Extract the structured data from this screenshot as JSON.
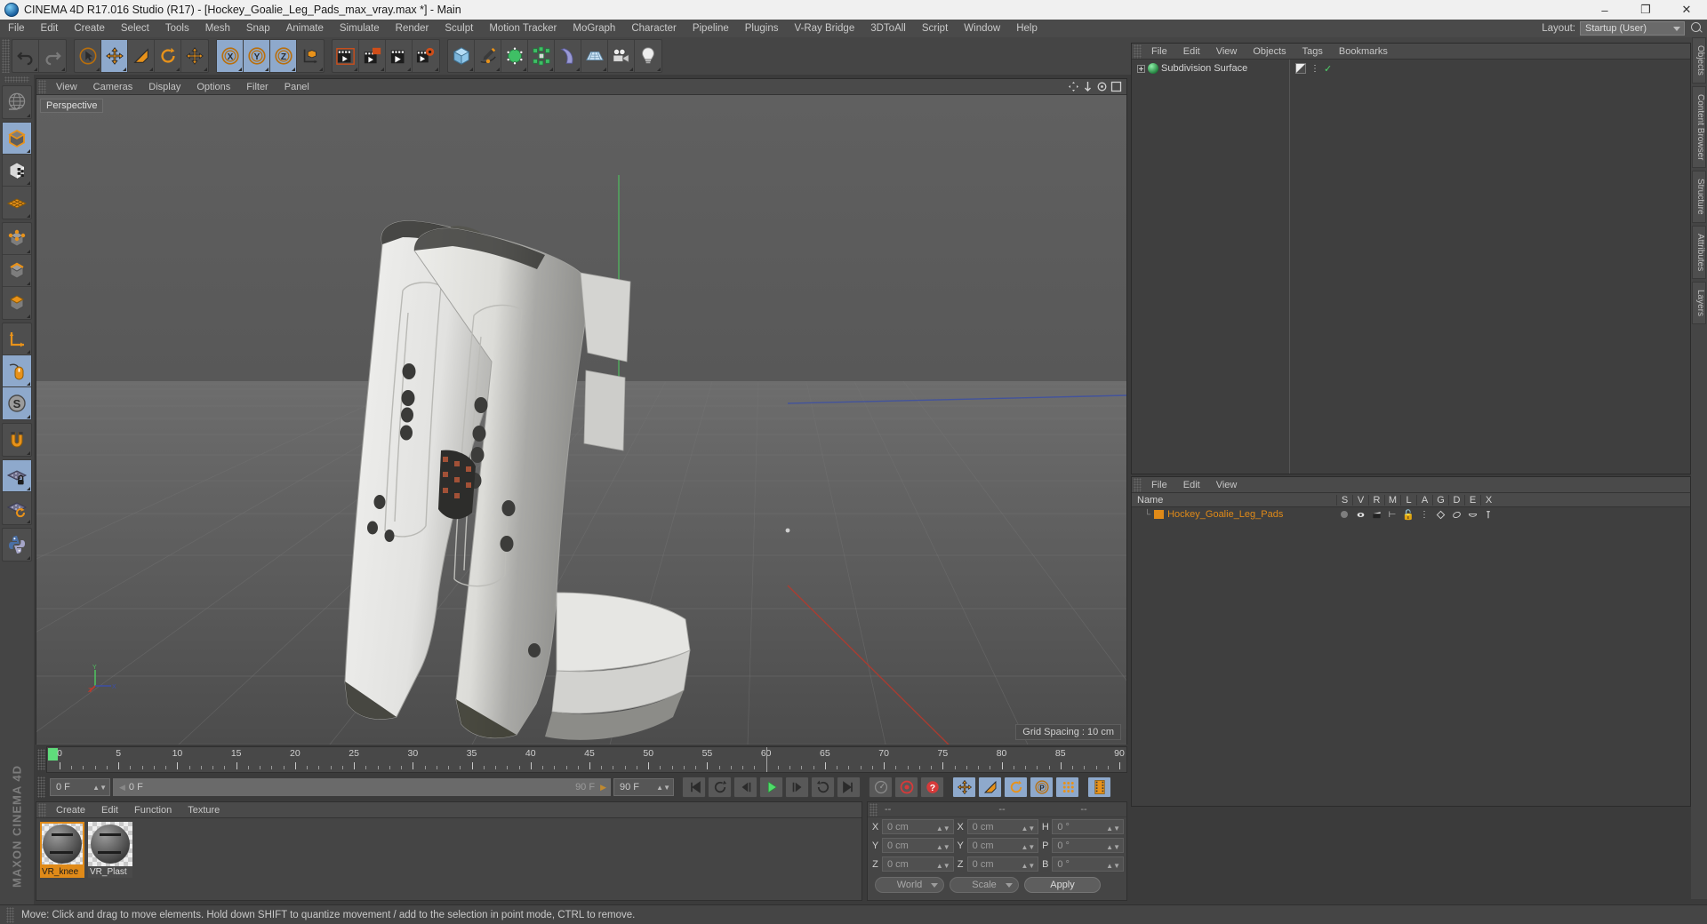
{
  "titlebar": {
    "title": "CINEMA 4D R17.016 Studio (R17) - [Hockey_Goalie_Leg_Pads_max_vray.max *] - Main",
    "minimize": "–",
    "maximize": "❐",
    "close": "✕"
  },
  "menubar": {
    "items": [
      "File",
      "Edit",
      "Create",
      "Select",
      "Tools",
      "Mesh",
      "Snap",
      "Animate",
      "Simulate",
      "Render",
      "Sculpt",
      "Motion Tracker",
      "MoGraph",
      "Character",
      "Pipeline",
      "Plugins",
      "V-Ray Bridge",
      "3DToAll",
      "Script",
      "Window",
      "Help"
    ],
    "layout_label": "Layout:",
    "layout_value": "Startup (User)"
  },
  "toolbar": {
    "groups": [
      {
        "name": "undo-redo",
        "buttons": [
          {
            "icon": "undo-icon",
            "selected": false
          },
          {
            "icon": "redo-icon",
            "selected": false
          }
        ]
      },
      {
        "name": "transform",
        "buttons": [
          {
            "icon": "select-cursor-icon",
            "selected": false
          },
          {
            "icon": "move-icon",
            "selected": true
          },
          {
            "icon": "scale-icon",
            "selected": false
          },
          {
            "icon": "rotate-icon",
            "selected": false
          },
          {
            "icon": "move-axis-icon",
            "selected": false
          }
        ]
      },
      {
        "name": "axis-locks",
        "buttons": [
          {
            "icon": "x-axis-icon",
            "selected": true
          },
          {
            "icon": "y-axis-icon",
            "selected": true
          },
          {
            "icon": "z-axis-icon",
            "selected": true
          },
          {
            "icon": "world-coord-icon",
            "selected": false
          }
        ]
      },
      {
        "name": "render",
        "buttons": [
          {
            "icon": "render-view-icon",
            "selected": false
          },
          {
            "icon": "render-region-icon",
            "selected": false
          },
          {
            "icon": "render-to-picture-viewer-icon",
            "selected": false
          },
          {
            "icon": "render-settings-icon",
            "selected": false
          }
        ]
      },
      {
        "name": "objects",
        "buttons": [
          {
            "icon": "cube-primitive-icon",
            "selected": false
          },
          {
            "icon": "spline-pen-icon",
            "selected": false
          },
          {
            "icon": "generator-nurbs-icon",
            "selected": false
          },
          {
            "icon": "array-deformer-icon",
            "selected": false
          },
          {
            "icon": "bend-deformer-icon",
            "selected": false
          },
          {
            "icon": "floor-environment-icon",
            "selected": false
          },
          {
            "icon": "camera-icon",
            "selected": false
          },
          {
            "icon": "light-icon",
            "selected": false
          }
        ]
      }
    ]
  },
  "lefttoolbar": {
    "buttons": [
      {
        "icon": "world-globe-icon",
        "selected": false
      },
      {
        "icon": "model-mode-icon",
        "selected": true
      },
      {
        "icon": "texture-mode-icon",
        "selected": false
      },
      {
        "icon": "polygon-mesh-icon",
        "selected": false
      },
      {
        "icon": "point-mode-icon",
        "selected": false
      },
      {
        "icon": "edge-mode-icon",
        "selected": false
      },
      {
        "icon": "polygon-mode-icon",
        "selected": false
      },
      {
        "icon": "axis-modify-icon",
        "selected": false
      },
      {
        "icon": "viewport-solo-mouse-icon",
        "selected": true
      },
      {
        "icon": "scale-s-icon",
        "selected": true
      },
      {
        "icon": "magnet-snap-icon",
        "selected": false
      },
      {
        "icon": "workplane-lock-icon",
        "selected": true
      },
      {
        "icon": "workplane-rotate-icon",
        "selected": false
      },
      {
        "icon": "python-script-icon",
        "selected": false
      }
    ],
    "branding": "MAXON CINEMA 4D"
  },
  "viewport": {
    "menu": [
      "View",
      "Cameras",
      "Display",
      "Options",
      "Filter",
      "Panel"
    ],
    "label": "Perspective",
    "grid_spacing": "Grid Spacing : 10 cm",
    "axis_labels": [
      "Y",
      "X",
      "Z"
    ]
  },
  "timeline": {
    "ticks": [
      0,
      5,
      10,
      15,
      20,
      25,
      30,
      35,
      40,
      45,
      50,
      55,
      60,
      65,
      70,
      75,
      80,
      85,
      90
    ],
    "start_frame": "0 F",
    "end_frame": "90 F",
    "current_frame": "0 F",
    "current_field": "0 F",
    "preview_end": "90 F",
    "range_end_field": "90 F",
    "right_field": "0 F",
    "transport": [
      {
        "icon": "goto-start-icon",
        "active": false
      },
      {
        "icon": "play-back-loop-icon",
        "active": false
      },
      {
        "icon": "step-back-icon",
        "active": false
      },
      {
        "icon": "play-forward-icon",
        "active": false
      },
      {
        "icon": "step-forward-icon",
        "active": false
      },
      {
        "icon": "loop-forward-icon",
        "active": false
      },
      {
        "icon": "goto-end-icon",
        "active": false
      },
      {
        "icon": "record-autokey-icon",
        "active": false
      },
      {
        "icon": "record-keyframe-icon",
        "active": false
      },
      {
        "icon": "key-selection-icon",
        "active": false
      },
      {
        "icon": "key-position-icon",
        "active": true
      },
      {
        "icon": "key-scale-icon",
        "active": true
      },
      {
        "icon": "key-rotation-icon",
        "active": true
      },
      {
        "icon": "key-parameter-icon",
        "active": true
      },
      {
        "icon": "point-level-anim-icon",
        "active": true
      },
      {
        "icon": "timeline-strip-icon",
        "active": true
      }
    ]
  },
  "material_manager": {
    "menu": [
      "Create",
      "Edit",
      "Function",
      "Texture"
    ],
    "materials": [
      {
        "name": "VR_knee",
        "selected": true
      },
      {
        "name": "VR_Plast",
        "selected": false
      }
    ]
  },
  "coordinates": {
    "headers": [
      "--",
      "--",
      "--"
    ],
    "rows": [
      {
        "l1": "X",
        "v1": "0 cm",
        "l2": "X",
        "v2": "0 cm",
        "l3": "H",
        "v3": "0 °"
      },
      {
        "l1": "Y",
        "v1": "0 cm",
        "l2": "Y",
        "v2": "0 cm",
        "l3": "P",
        "v3": "0 °"
      },
      {
        "l1": "Z",
        "v1": "0 cm",
        "l2": "Z",
        "v2": "0 cm",
        "l3": "B",
        "v3": "0 °"
      }
    ],
    "system": "World",
    "mode": "Scale",
    "apply": "Apply"
  },
  "object_manager": {
    "menu": [
      "File",
      "Edit",
      "View",
      "Objects",
      "Tags",
      "Bookmarks"
    ],
    "rows": [
      {
        "label": "Subdivision Surface",
        "icon": "subdivision-surface-icon"
      }
    ]
  },
  "attribute_manager": {
    "menu": [
      "File",
      "Edit",
      "View"
    ],
    "columns": [
      "Name",
      "S",
      "V",
      "R",
      "M",
      "L",
      "A",
      "G",
      "D",
      "E",
      "X"
    ],
    "rows": [
      {
        "name": "Hockey_Goalie_Leg_Pads"
      }
    ]
  },
  "right_tabs": [
    "Objects",
    "Content Browser",
    "Structure",
    "Attributes",
    "Layers"
  ],
  "statusbar": {
    "message": "Move: Click and drag to move elements. Hold down SHIFT to quantize movement / add to the selection in point mode, CTRL to remove."
  },
  "colors": {
    "accent_orange": "#e08a18",
    "selected_blue": "#8ea9cc",
    "panel_bg": "#454545",
    "viewport_sky": "#5c5c5c",
    "green_axis": "#3fbf4f",
    "red_axis": "#c0392b",
    "blue_axis": "#3b4fa8"
  }
}
